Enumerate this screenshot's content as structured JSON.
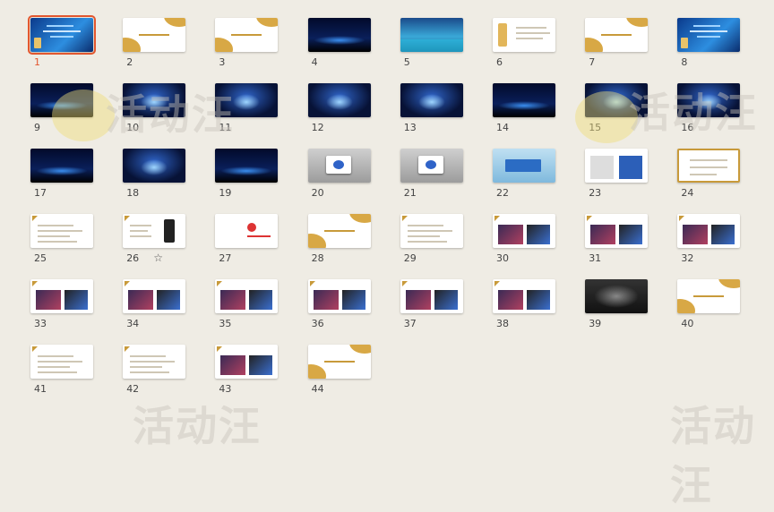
{
  "selected_slide": "1",
  "watermark_text": "活动汪",
  "slides": [
    {
      "number": "1",
      "style": "blue",
      "selected": true,
      "star": false
    },
    {
      "number": "2",
      "style": "white-gold",
      "selected": false,
      "star": false
    },
    {
      "number": "3",
      "style": "white-gold",
      "selected": false,
      "star": false
    },
    {
      "number": "4",
      "style": "night",
      "selected": false,
      "star": false
    },
    {
      "number": "5",
      "style": "water",
      "selected": false,
      "star": false
    },
    {
      "number": "6",
      "style": "white-bottle",
      "selected": false,
      "star": false
    },
    {
      "number": "7",
      "style": "white-gold",
      "selected": false,
      "star": false
    },
    {
      "number": "8",
      "style": "blue",
      "selected": false,
      "star": false
    },
    {
      "number": "9",
      "style": "night",
      "selected": false,
      "star": false
    },
    {
      "number": "10",
      "style": "stage",
      "selected": false,
      "star": false
    },
    {
      "number": "11",
      "style": "stage",
      "selected": false,
      "star": false
    },
    {
      "number": "12",
      "style": "stage",
      "selected": false,
      "star": false
    },
    {
      "number": "13",
      "style": "stage",
      "selected": false,
      "star": false
    },
    {
      "number": "14",
      "style": "night",
      "selected": false,
      "star": false
    },
    {
      "number": "15",
      "style": "stage",
      "selected": false,
      "star": false
    },
    {
      "number": "16",
      "style": "stage",
      "selected": false,
      "star": false
    },
    {
      "number": "17",
      "style": "night",
      "selected": false,
      "star": false
    },
    {
      "number": "18",
      "style": "stage",
      "selected": false,
      "star": false
    },
    {
      "number": "19",
      "style": "night",
      "selected": false,
      "star": false
    },
    {
      "number": "20",
      "style": "grey",
      "selected": false,
      "star": false
    },
    {
      "number": "21",
      "style": "grey",
      "selected": false,
      "star": false
    },
    {
      "number": "22",
      "style": "sign",
      "selected": false,
      "star": false
    },
    {
      "number": "23",
      "style": "white-panels",
      "selected": false,
      "star": false
    },
    {
      "number": "24",
      "style": "gold-border",
      "selected": false,
      "star": false
    },
    {
      "number": "25",
      "style": "white-text",
      "selected": false,
      "star": false
    },
    {
      "number": "26",
      "style": "white-phone",
      "selected": false,
      "star": true
    },
    {
      "number": "27",
      "style": "white-logo",
      "selected": false,
      "star": false
    },
    {
      "number": "28",
      "style": "white-gold",
      "selected": false,
      "star": false
    },
    {
      "number": "29",
      "style": "white-text",
      "selected": false,
      "star": false
    },
    {
      "number": "30",
      "style": "white-photos",
      "selected": false,
      "star": false
    },
    {
      "number": "31",
      "style": "white-photos",
      "selected": false,
      "star": false
    },
    {
      "number": "32",
      "style": "white-photos",
      "selected": false,
      "star": false
    },
    {
      "number": "33",
      "style": "white-photos",
      "selected": false,
      "star": false
    },
    {
      "number": "34",
      "style": "white-photos",
      "selected": false,
      "star": false
    },
    {
      "number": "35",
      "style": "white-photos",
      "selected": false,
      "star": false
    },
    {
      "number": "36",
      "style": "white-photos",
      "selected": false,
      "star": false
    },
    {
      "number": "37",
      "style": "white-photos",
      "selected": false,
      "star": false
    },
    {
      "number": "38",
      "style": "white-photos",
      "selected": false,
      "star": false
    },
    {
      "number": "39",
      "style": "dark",
      "selected": false,
      "star": false
    },
    {
      "number": "40",
      "style": "white-gold",
      "selected": false,
      "star": false
    },
    {
      "number": "41",
      "style": "white-text",
      "selected": false,
      "star": false
    },
    {
      "number": "42",
      "style": "white-text",
      "selected": false,
      "star": false
    },
    {
      "number": "43",
      "style": "white-photos",
      "selected": false,
      "star": false
    },
    {
      "number": "44",
      "style": "white-gold",
      "selected": false,
      "star": false
    }
  ],
  "colors": {
    "background": "#efece4",
    "selection": "#e2572f",
    "gold": "#d8a845"
  }
}
